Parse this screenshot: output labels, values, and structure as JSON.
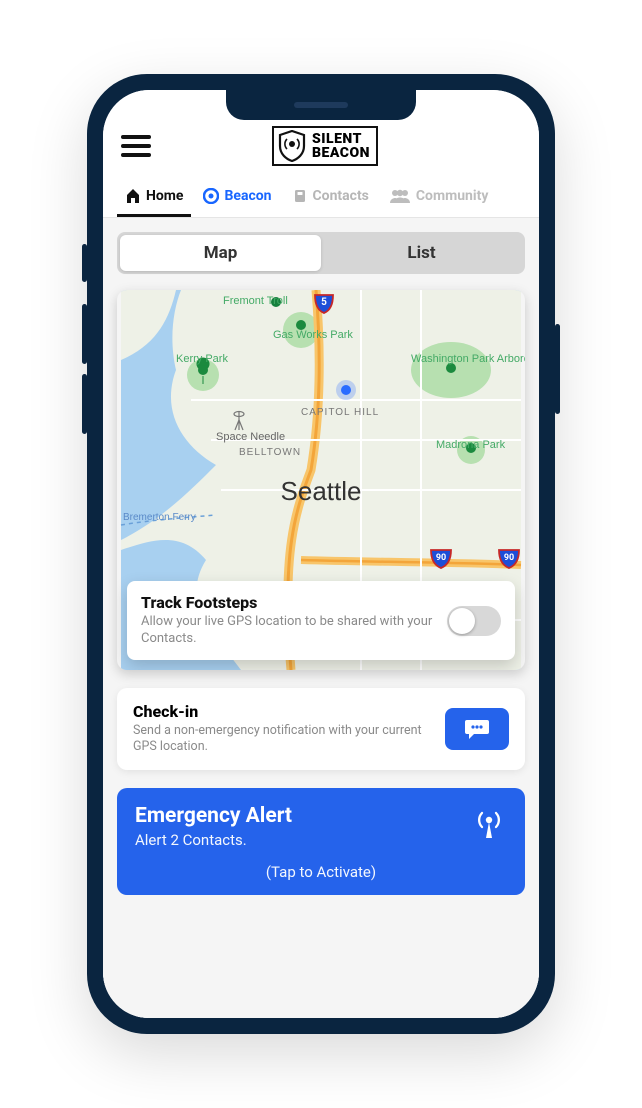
{
  "brand": {
    "line1": "SILENT",
    "line2": "BEACON"
  },
  "tabs": {
    "home": {
      "label": "Home"
    },
    "beacon": {
      "label": "Beacon"
    },
    "contacts": {
      "label": "Contacts"
    },
    "community": {
      "label": "Community"
    }
  },
  "segmented": {
    "map": "Map",
    "list": "List"
  },
  "map": {
    "city": "Seattle",
    "labels": {
      "fremont_troll": "Fremont Troll",
      "gas_works": "Gas Works Park",
      "kerry_park": "Kerry Park",
      "washington_park": "Washington Park Arboretum",
      "capitol_hill": "CAPITOL HILL",
      "space_needle": "Space Needle",
      "belltown": "BELLTOWN",
      "madrona": "Madrona Park",
      "ferry": "Bremerton Ferry"
    },
    "shields": {
      "i5": "5",
      "i90": "90"
    }
  },
  "track": {
    "title": "Track Footsteps",
    "desc": "Allow your live GPS location to be shared with your Contacts.",
    "enabled": false
  },
  "checkin": {
    "title": "Check-in",
    "desc": "Send a non-emergency notification with your current GPS location."
  },
  "alert": {
    "title": "Emergency Alert",
    "sub": "Alert 2 Contacts.",
    "tap": "(Tap to Activate)"
  }
}
